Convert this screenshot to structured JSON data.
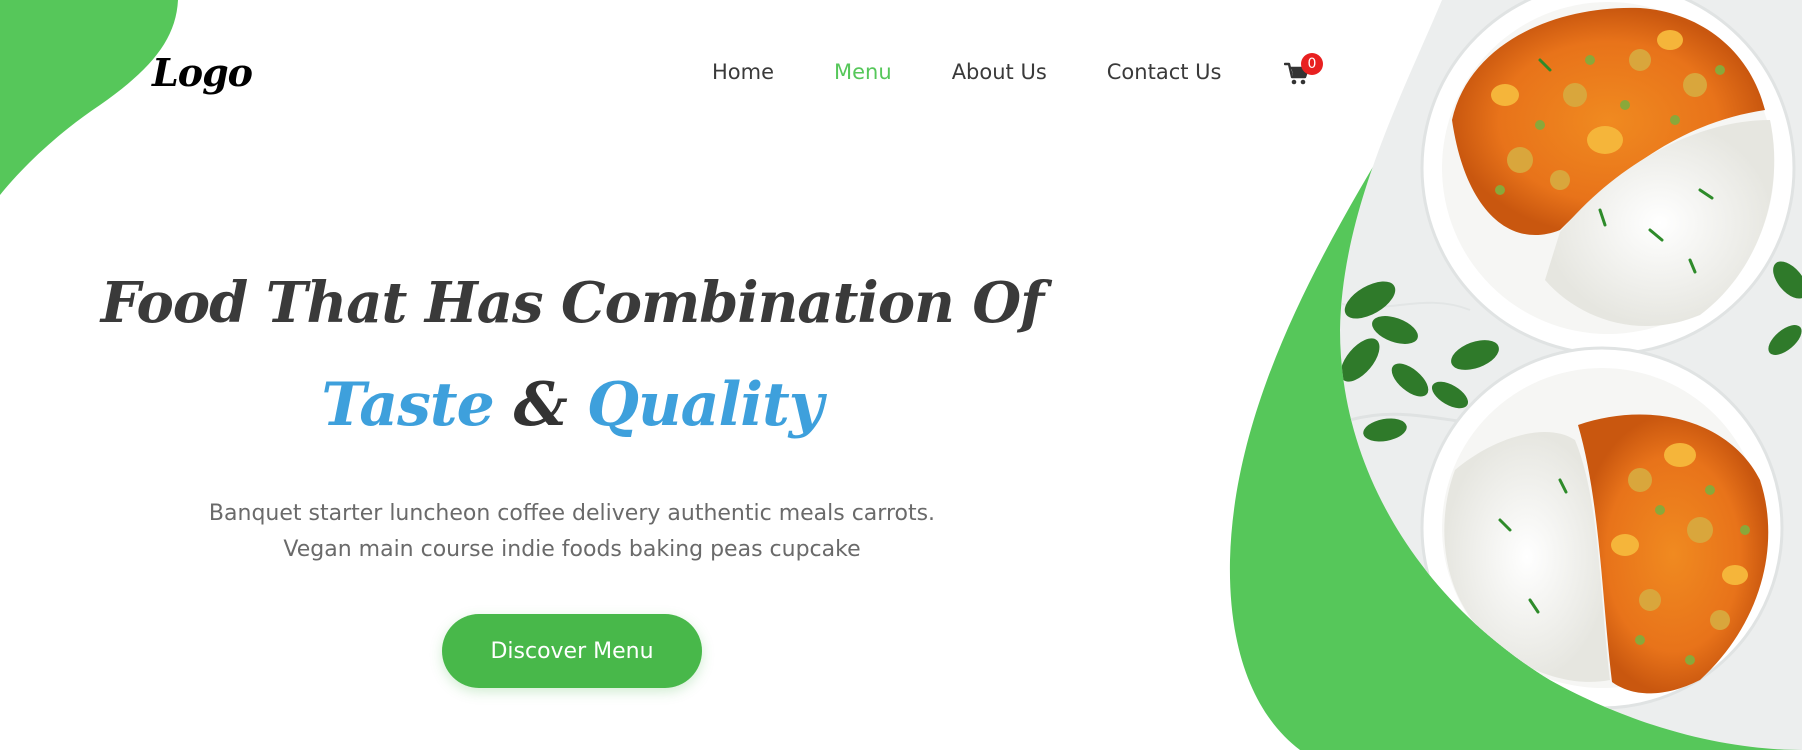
{
  "brand": {
    "logo_text": "Logo",
    "accent_green": "#56c75a",
    "accent_blue": "#3ea0dc"
  },
  "nav": {
    "items": [
      {
        "label": "Home",
        "active": false
      },
      {
        "label": "Menu",
        "active": true
      },
      {
        "label": "About Us",
        "active": false
      },
      {
        "label": "Contact Us",
        "active": false
      }
    ],
    "cart_icon": "shopping-cart-icon",
    "cart_count": "0"
  },
  "hero": {
    "title": "Food That Has Combination Of",
    "highlight_1": "Taste",
    "ampersand": "&",
    "highlight_2": "Quality",
    "description_line_1": "Banquet starter luncheon coffee delivery authentic meals carrots.",
    "description_line_2": "Vegan main course indie foods baking peas cupcake",
    "cta_label": "Discover Menu"
  }
}
